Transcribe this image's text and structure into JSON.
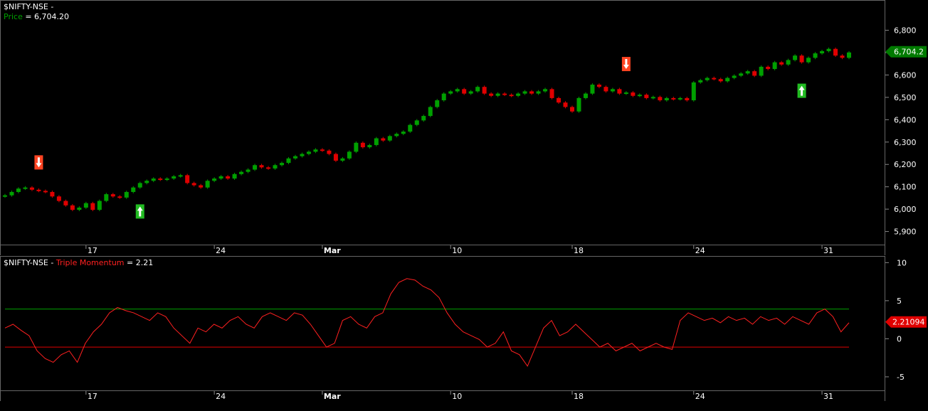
{
  "price_pane": {
    "symbol_label": "$NIFTY-NSE -",
    "price_label": "Price",
    "price_value": "= 6,704.20",
    "last_badge": "6,704.2",
    "y_ticks": [
      "6,800",
      "6,700",
      "6,600",
      "6,500",
      "6,400",
      "6,300",
      "6,200",
      "6,100",
      "6,000",
      "5,900"
    ]
  },
  "indicator_pane": {
    "symbol_label": "$NIFTY-NSE -",
    "indicator_label": "Triple Momentum",
    "indicator_value": "= 2.21",
    "last_badge": "2.21094",
    "y_ticks": [
      "10",
      "5",
      "0",
      "-5"
    ]
  },
  "x_ticks": [
    "17",
    "24",
    "Mar",
    "10",
    "18",
    "24",
    "31"
  ],
  "colors": {
    "up": "#00a000",
    "down": "#e00000",
    "momentum_line": "#ff2020",
    "upper_level": "#00a000",
    "lower_level": "#e00000",
    "buy_arrow": "#22bb22",
    "sell_arrow": "#ff4422",
    "axis_text": "#ffffff"
  },
  "chart_data": [
    {
      "type": "candlestick",
      "title": "$NIFTY-NSE",
      "ylim": [
        5870,
        6840
      ],
      "close": [
        6065,
        6080,
        6095,
        6100,
        6090,
        6085,
        6080,
        6060,
        6040,
        6020,
        6000,
        6010,
        6030,
        6000,
        6040,
        6070,
        6060,
        6055,
        6080,
        6100,
        6120,
        6130,
        6140,
        6135,
        6140,
        6150,
        6155,
        6120,
        6110,
        6100,
        6130,
        6140,
        6150,
        6140,
        6160,
        6170,
        6180,
        6200,
        6190,
        6185,
        6200,
        6210,
        6230,
        6240,
        6250,
        6260,
        6270,
        6265,
        6250,
        6220,
        6230,
        6260,
        6300,
        6280,
        6290,
        6320,
        6310,
        6330,
        6340,
        6350,
        6380,
        6400,
        6420,
        6460,
        6490,
        6520,
        6530,
        6540,
        6520,
        6530,
        6550,
        6520,
        6510,
        6520,
        6515,
        6510,
        6520,
        6530,
        6520,
        6530,
        6540,
        6500,
        6480,
        6460,
        6440,
        6500,
        6520,
        6560,
        6550,
        6530,
        6540,
        6520,
        6525,
        6510,
        6515,
        6500,
        6505,
        6490,
        6500,
        6495,
        6500,
        6490,
        6570,
        6580,
        6590,
        6585,
        6575,
        6590,
        6600,
        6610,
        6620,
        6600,
        6640,
        6630,
        6660,
        6650,
        6670,
        6690,
        6660,
        6680,
        6700,
        6710,
        6720,
        6690,
        6680,
        6704
      ],
      "signals": [
        {
          "type": "sell",
          "index": 5
        },
        {
          "type": "buy",
          "index": 20
        },
        {
          "type": "sell",
          "index": 92
        },
        {
          "type": "buy",
          "index": 118
        }
      ],
      "last_value": 6704.2
    },
    {
      "type": "line",
      "title": "Triple Momentum",
      "ylim": [
        -6.5,
        10.5
      ],
      "levels": [
        4,
        -1
      ],
      "x": [
        0,
        1,
        2,
        3,
        4,
        5,
        6,
        7,
        8,
        9,
        10,
        11,
        12,
        13,
        14,
        15,
        16,
        17,
        18,
        19,
        20,
        21,
        22,
        23,
        24,
        25,
        26,
        27,
        28,
        29,
        30,
        31,
        32,
        33,
        34,
        35,
        36,
        37,
        38,
        39,
        40,
        41,
        42,
        43,
        44,
        45,
        46,
        47,
        48,
        49,
        50,
        51,
        52,
        53,
        54,
        55,
        56,
        57,
        58,
        59,
        60,
        61,
        62,
        63,
        64,
        65,
        66,
        67,
        68,
        69,
        70,
        71,
        72,
        73,
        74,
        75,
        76,
        77,
        78,
        79,
        80,
        81,
        82,
        83,
        84,
        85,
        86,
        87,
        88,
        89,
        90,
        91,
        92,
        93,
        94,
        95,
        96,
        97,
        98,
        99,
        100,
        101,
        102,
        103,
        104,
        105,
        106,
        107,
        108,
        109,
        110,
        111,
        112,
        113,
        114,
        115,
        116,
        117,
        118,
        119,
        120,
        121,
        122,
        123,
        124,
        125
      ],
      "y": [
        1.5,
        2,
        1.2,
        0.5,
        -1.5,
        -2.5,
        -3,
        -2,
        -1.5,
        -3,
        -0.5,
        1,
        2,
        3.5,
        4.2,
        3.8,
        3.5,
        3,
        2.5,
        3.5,
        3,
        1.5,
        0.5,
        -0.5,
        1.5,
        1,
        2,
        1.5,
        2.5,
        3,
        2,
        1.5,
        3,
        3.5,
        3,
        2.5,
        3.5,
        3.2,
        2,
        0.5,
        -1,
        -0.5,
        2.5,
        3,
        2,
        1.5,
        3,
        3.5,
        6,
        7.5,
        8,
        7.8,
        7,
        6.5,
        5.5,
        3.5,
        2,
        1,
        0.5,
        0,
        -1,
        -0.5,
        1,
        -1.5,
        -2,
        -3.5,
        -1,
        1.5,
        2.5,
        0.5,
        1,
        2,
        1,
        0,
        -1,
        -0.5,
        -1.5,
        -1,
        -0.5,
        -1.5,
        -1,
        -0.5,
        -1,
        -1.3,
        2.5,
        3.5,
        3,
        2.5,
        2.8,
        2.2,
        3,
        2.5,
        2.8,
        2,
        3,
        2.5,
        2.8,
        2,
        3,
        2.5,
        2,
        3.5,
        4,
        3,
        1,
        2.2
      ],
      "last_value": 2.21094
    }
  ]
}
